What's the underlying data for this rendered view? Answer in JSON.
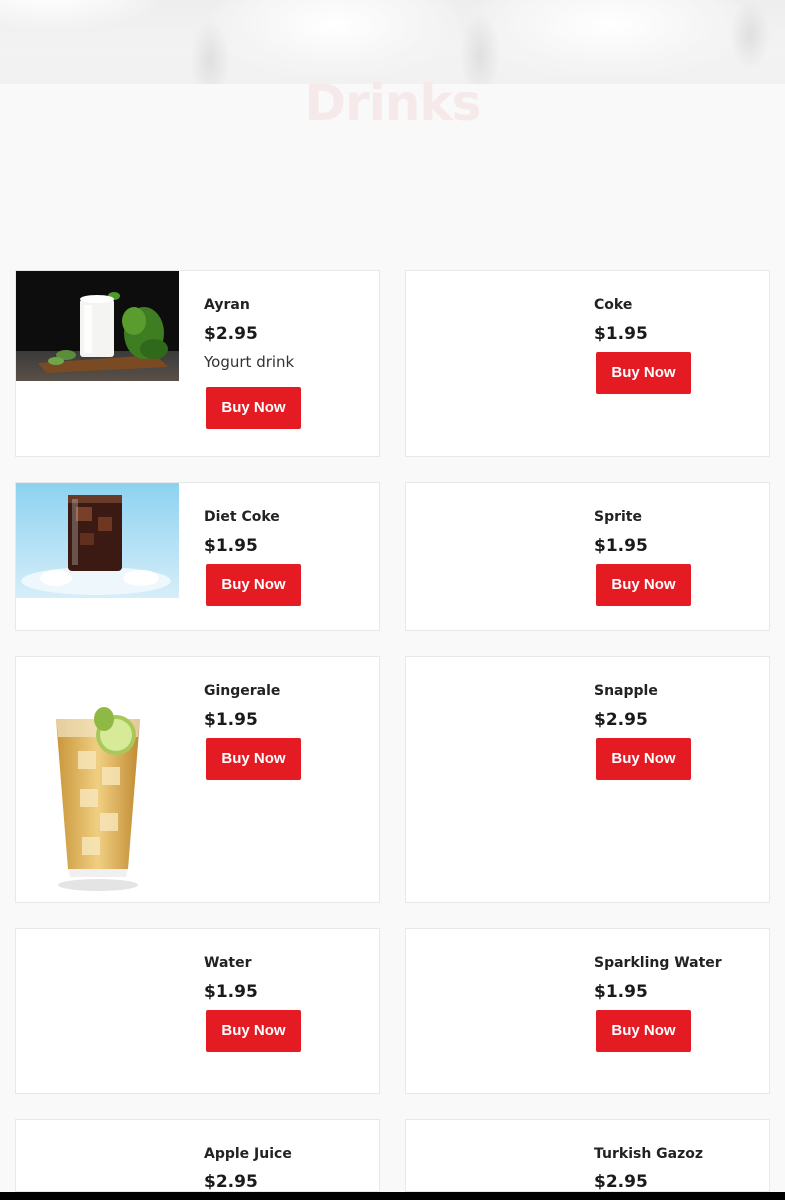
{
  "page": {
    "title": "Drinks"
  },
  "buy_label": "Buy Now",
  "colors": {
    "accent": "#e51b24",
    "background": "#f9f9f9",
    "title": "#f6e9ea"
  },
  "products": [
    {
      "name": "Ayran",
      "price": "$2.95",
      "description": "Yogurt drink",
      "image": "ayran-glass-photo"
    },
    {
      "name": "Coke",
      "price": "$1.95"
    },
    {
      "name": "Diet Coke",
      "price": "$1.95",
      "image": "cola-glass-ice-photo"
    },
    {
      "name": "Sprite",
      "price": "$1.95"
    },
    {
      "name": "Gingerale",
      "price": "$1.95",
      "image": "gingerale-glass-lime-photo"
    },
    {
      "name": "Snapple",
      "price": "$2.95"
    },
    {
      "name": "Water",
      "price": "$1.95"
    },
    {
      "name": "Sparkling Water",
      "price": "$1.95"
    },
    {
      "name": "Apple Juice",
      "price": "$2.95"
    },
    {
      "name": "Turkish Gazoz",
      "price": "$2.95"
    }
  ]
}
